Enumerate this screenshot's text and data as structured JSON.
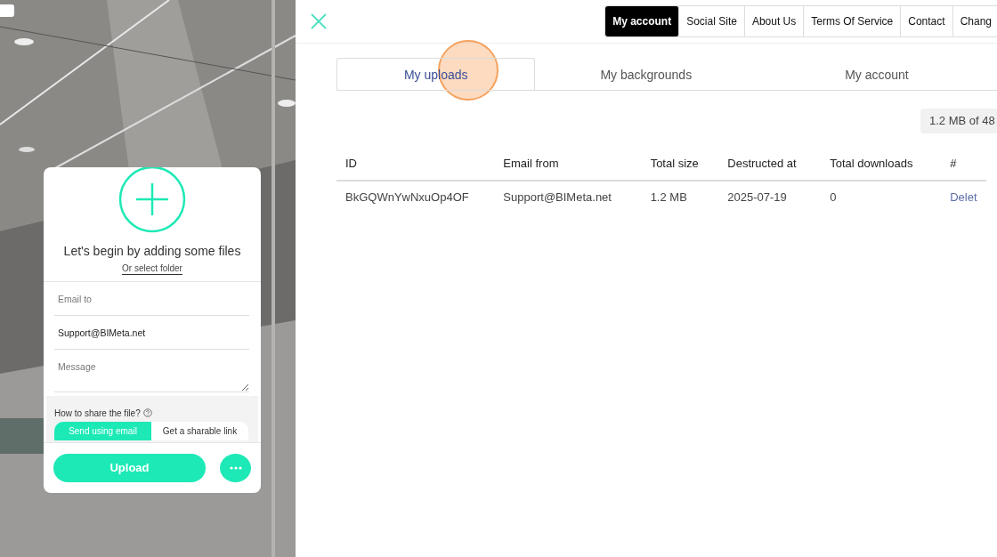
{
  "upload_card": {
    "title": "Let's begin by adding some files",
    "folder_link": "Or select folder",
    "email_to": {
      "placeholder": "Email to"
    },
    "email_from": {
      "value": "Support@BIMeta.net"
    },
    "message": {
      "placeholder": "Message"
    },
    "share": {
      "question": "How to share the file?",
      "options": [
        {
          "label": "Send using email",
          "selected": true
        },
        {
          "label": "Get a sharable link",
          "selected": false
        }
      ]
    },
    "upload_button": "Upload"
  },
  "nav": [
    {
      "label": "My account",
      "selected": true
    },
    {
      "label": "Social Site",
      "selected": false
    },
    {
      "label": "About Us",
      "selected": false
    },
    {
      "label": "Terms Of Service",
      "selected": false
    },
    {
      "label": "Contact",
      "selected": false
    },
    {
      "label": "Chang",
      "selected": false
    }
  ],
  "tabs": [
    {
      "label": "My uploads",
      "selected": true
    },
    {
      "label": "My backgrounds",
      "selected": false
    },
    {
      "label": "My account",
      "selected": false
    }
  ],
  "storage": "1.2 MB of 48",
  "table": {
    "columns": [
      "ID",
      "Email from",
      "Total size",
      "Destructed at",
      "Total downloads",
      "#"
    ],
    "rows": [
      {
        "cells": [
          "BkGQWnYwNxuOp4OF",
          "Support@BIMeta.net",
          "1.2 MB",
          "2025-07-19",
          "0"
        ],
        "action": "Delet"
      }
    ]
  }
}
